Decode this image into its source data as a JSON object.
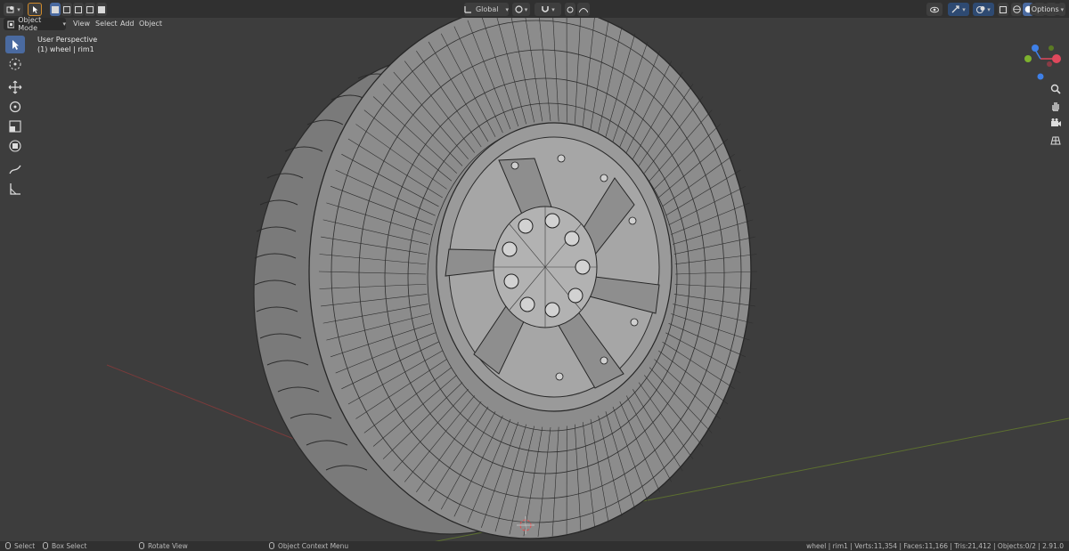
{
  "header": {
    "transform_orientation": "Global",
    "options_label": "Options"
  },
  "menu": {
    "mode": "Object Mode",
    "items": [
      "View",
      "Select",
      "Add",
      "Object"
    ]
  },
  "viewport": {
    "perspective_label": "User Perspective",
    "object_label": "(1) wheel | rim1"
  },
  "gizmo": {
    "axis_x_color": "#e0485c",
    "axis_y_color": "#7db22e",
    "axis_z_color": "#3e80e8"
  },
  "statusbar": {
    "select": "Select",
    "box_select": "Box Select",
    "rotate_view": "Rotate View",
    "context_menu": "Object Context Menu",
    "stats": "wheel | rim1 | Verts:11,354 | Faces:11,166 | Tris:21,412 | Objects:0/2 | 2.91.0"
  }
}
